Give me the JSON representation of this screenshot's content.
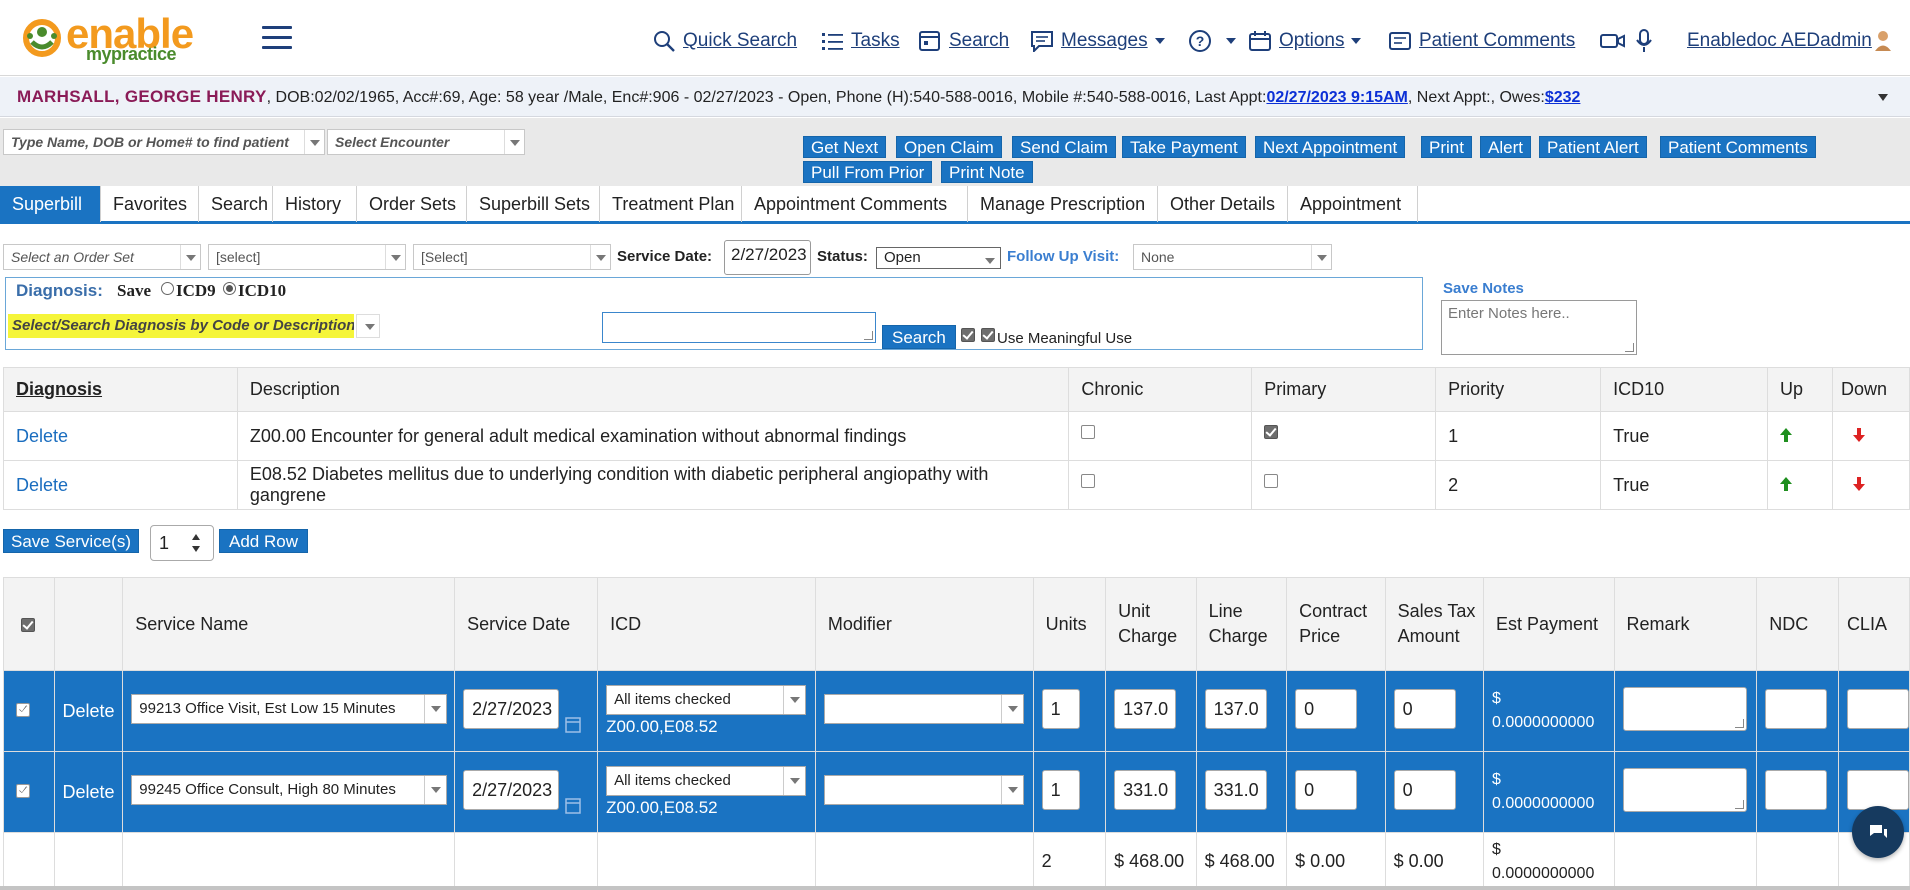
{
  "brand": {
    "name": "enable",
    "sub": "mypractice"
  },
  "nav": {
    "quick_search": "Quick Search",
    "tasks": "Tasks",
    "search": "Search",
    "messages": "Messages",
    "options": "Options",
    "patient_comments": "Patient Comments",
    "user": "Enabledoc AEDadmin"
  },
  "patient": {
    "name": "MARHSALL, GEORGE HENRY",
    "info": ", DOB:02/02/1965, Acc#:69, Age: 58 year /Male, Enc#:906 - 02/27/2023 - Open, Phone (H):540-588-0016, Mobile #:540-588-0016, Last Appt:",
    "last_appt": "02/27/2023 9:15AM",
    "next_appt_label": ", Next Appt:, Owes:",
    "owes": "$232"
  },
  "finder": {
    "patient_placeholder": "Type Name, DOB or Home# to find patient",
    "encounter_placeholder": "Select Encounter"
  },
  "actions": [
    "Get Next",
    "Open Claim",
    "Send Claim",
    "Take Payment",
    "Next Appointment",
    "Print",
    "Alert",
    "Patient Alert",
    "Patient Comments"
  ],
  "actions2": [
    "Pull From Prior",
    "Print Note"
  ],
  "tabs": [
    "Superbill",
    "Favorites",
    "Search",
    "History",
    "Order Sets",
    "Superbill Sets",
    "Treatment Plan",
    "Appointment Comments",
    "Manage Prescription",
    "Other Details",
    "Appointment"
  ],
  "filters": {
    "order_set": "Select an Order Set",
    "select1": "[select]",
    "select2": "[Select]",
    "service_date_label": "Service Date:",
    "service_date": "2/27/2023",
    "status_label": "Status:",
    "status": "Open",
    "follow_up_label": "Follow Up Visit:",
    "follow_up": "None"
  },
  "diagnosis_panel": {
    "label": "Diagnosis:",
    "save": "Save",
    "icd9": "ICD9",
    "icd10": "ICD10",
    "search_placeholder": "Select/Search Diagnosis by Code or Description",
    "search_button": "Search",
    "meaningful_use": "Use Meaningful Use",
    "save_notes": "Save Notes",
    "notes_placeholder": "Enter Notes here.."
  },
  "diag_table": {
    "headers": [
      "Diagnosis",
      "Description",
      "Chronic",
      "Primary",
      "Priority",
      "ICD10",
      "Up",
      "Down"
    ],
    "rows": [
      {
        "action": "Delete",
        "description": "Z00.00 Encounter for general adult medical examination without abnormal findings",
        "priority": "1",
        "icd10": "True",
        "chronic": false,
        "primary": true
      },
      {
        "action": "Delete",
        "description": "E08.52 Diabetes mellitus due to underlying condition with diabetic peripheral angiopathy with gangrene",
        "priority": "2",
        "icd10": "True",
        "chronic": false,
        "primary": false
      }
    ]
  },
  "service_controls": {
    "save": "Save Service(s)",
    "count": "1",
    "add_row": "Add Row"
  },
  "service_table": {
    "headers": [
      "Service Name",
      "Service Date",
      "ICD",
      "Modifier",
      "Units",
      "Unit Charge",
      "Line Charge",
      "Contract Price",
      "Sales Tax Amount",
      "Est Payment",
      "Remark",
      "NDC",
      "CLIA"
    ],
    "rows": [
      {
        "action": "Delete",
        "service": "99213 Office Visit, Est Low 15 Minutes",
        "date": "2/27/2023",
        "icd_select": "All items checked",
        "icd_codes": "Z00.00,E08.52",
        "units": "1",
        "unit_charge": "137.0",
        "line_charge": "137.0",
        "contract": "0",
        "tax": "0",
        "est_dollar": "$",
        "est_value": "0.0000000000"
      },
      {
        "action": "Delete",
        "service": "99245 Office Consult, High 80 Minutes",
        "date": "2/27/2023",
        "icd_select": "All items checked",
        "icd_codes": "Z00.00,E08.52",
        "units": "1",
        "unit_charge": "331.0",
        "line_charge": "331.0",
        "contract": "0",
        "tax": "0",
        "est_dollar": "$",
        "est_value": "0.0000000000"
      }
    ],
    "totals": {
      "units": "2",
      "unit_charge": "$ 468.00",
      "line_charge": "$ 468.00",
      "contract": "$ 0.00",
      "tax": "$ 0.00",
      "est_dollar": "$",
      "est_value": "0.0000000000"
    }
  }
}
